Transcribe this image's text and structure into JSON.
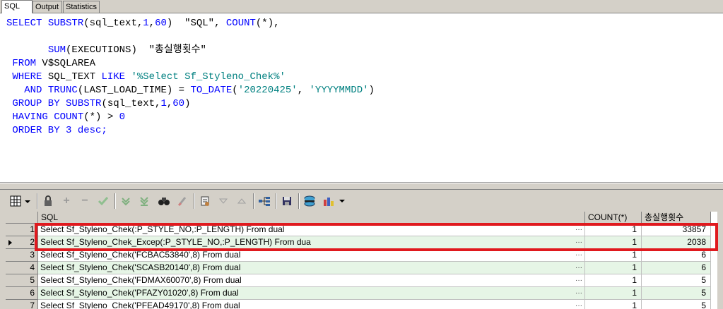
{
  "tabs": [
    "SQL",
    "Output",
    "Statistics"
  ],
  "editor": {
    "lines": [
      [
        {
          "t": "SELECT ",
          "c": "kw"
        },
        {
          "t": "SUBSTR",
          "c": "fn"
        },
        {
          "t": "(sql_text,",
          "c": "id"
        },
        {
          "t": "1",
          "c": "num"
        },
        {
          "t": ",",
          "c": "id"
        },
        {
          "t": "60",
          "c": "num"
        },
        {
          "t": ")  \"SQL\", ",
          "c": "id"
        },
        {
          "t": "COUNT",
          "c": "fn"
        },
        {
          "t": "(*),",
          "c": "id"
        }
      ],
      [],
      [
        {
          "t": "       ",
          "c": "id"
        },
        {
          "t": "SUM",
          "c": "fn"
        },
        {
          "t": "(EXECUTIONS)  \"총실행횟수\"",
          "c": "id"
        }
      ],
      [
        {
          "t": " FROM ",
          "c": "kw"
        },
        {
          "t": "V$SQLAREA",
          "c": "id"
        }
      ],
      [
        {
          "t": " WHERE ",
          "c": "kw"
        },
        {
          "t": "SQL_TEXT ",
          "c": "id"
        },
        {
          "t": "LIKE ",
          "c": "kw"
        },
        {
          "t": "'%Select Sf_Styleno_Chek%'",
          "c": "str"
        }
      ],
      [
        {
          "t": "   AND ",
          "c": "kw"
        },
        {
          "t": "TRUNC",
          "c": "fn"
        },
        {
          "t": "(LAST_LOAD_TIME) = ",
          "c": "id"
        },
        {
          "t": "TO_DATE",
          "c": "fn"
        },
        {
          "t": "(",
          "c": "id"
        },
        {
          "t": "'20220425'",
          "c": "str"
        },
        {
          "t": ", ",
          "c": "id"
        },
        {
          "t": "'YYYYMMDD'",
          "c": "str"
        },
        {
          "t": ")",
          "c": "id"
        }
      ],
      [
        {
          "t": " GROUP BY ",
          "c": "kw"
        },
        {
          "t": "SUBSTR",
          "c": "fn"
        },
        {
          "t": "(sql_text,",
          "c": "id"
        },
        {
          "t": "1",
          "c": "num"
        },
        {
          "t": ",",
          "c": "id"
        },
        {
          "t": "60",
          "c": "num"
        },
        {
          "t": ")",
          "c": "id"
        }
      ],
      [
        {
          "t": " HAVING ",
          "c": "kw"
        },
        {
          "t": "COUNT",
          "c": "fn"
        },
        {
          "t": "(*) > ",
          "c": "id"
        },
        {
          "t": "0",
          "c": "num"
        }
      ],
      [
        {
          "t": " ORDER BY ",
          "c": "kw"
        },
        {
          "t": "3 ",
          "c": "num"
        },
        {
          "t": "desc;",
          "c": "kw"
        }
      ]
    ]
  },
  "grid": {
    "columns": [
      "SQL",
      "COUNT(*)",
      "총실행횟수"
    ],
    "rows": [
      {
        "num": "1",
        "sql": "Select Sf_Styleno_Chek(:P_STYLE_NO,:P_LENGTH) From dual",
        "count": "1",
        "total": "33857"
      },
      {
        "num": "2",
        "sql": "Select Sf_Styleno_Chek_Excep(:P_STYLE_NO,:P_LENGTH) From dua",
        "count": "1",
        "total": "2038"
      },
      {
        "num": "3",
        "sql": "Select Sf_Styleno_Chek('FCBAC53840',8) From dual",
        "count": "1",
        "total": "6"
      },
      {
        "num": "4",
        "sql": "Select Sf_Styleno_Chek('SCASB20140',8) From dual",
        "count": "1",
        "total": "6"
      },
      {
        "num": "5",
        "sql": "Select Sf_Styleno_Chek('FDMAX60070',8) From dual",
        "count": "1",
        "total": "5"
      },
      {
        "num": "6",
        "sql": "Select Sf_Styleno_Chek('PFAZY01020',8) From dual",
        "count": "1",
        "total": "5"
      },
      {
        "num": "7",
        "sql": "Select Sf_Styleno_Chek('PFEAD49170',8) From dual",
        "count": "1",
        "total": "5"
      }
    ],
    "current_row": 2,
    "ellipsis": "···"
  },
  "toolbar": {
    "icons": [
      "grid-icon",
      "lock-icon",
      "add-icon",
      "remove-icon",
      "check-icon",
      "first-icon",
      "last-icon",
      "find-icon",
      "clear-icon",
      "print-icon",
      "down-icon",
      "up-icon",
      "tree-icon",
      "save-icon",
      "db-icon",
      "chart-icon"
    ]
  },
  "colors": {
    "keyword": "#0000ff",
    "string": "#008080",
    "highlight": "#e0191e",
    "row_alt": "#e6f5e6"
  }
}
